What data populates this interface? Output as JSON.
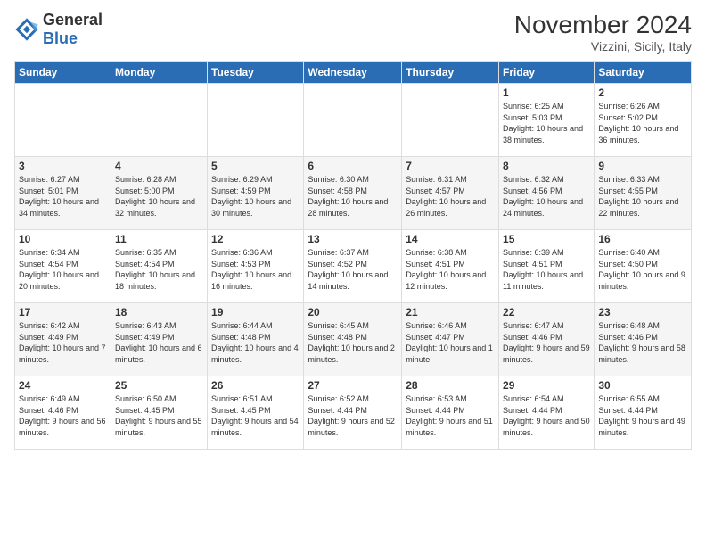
{
  "header": {
    "logo_general": "General",
    "logo_blue": "Blue",
    "month_title": "November 2024",
    "subtitle": "Vizzini, Sicily, Italy"
  },
  "days_of_week": [
    "Sunday",
    "Monday",
    "Tuesday",
    "Wednesday",
    "Thursday",
    "Friday",
    "Saturday"
  ],
  "weeks": [
    [
      {
        "day": "",
        "info": ""
      },
      {
        "day": "",
        "info": ""
      },
      {
        "day": "",
        "info": ""
      },
      {
        "day": "",
        "info": ""
      },
      {
        "day": "",
        "info": ""
      },
      {
        "day": "1",
        "info": "Sunrise: 6:25 AM\nSunset: 5:03 PM\nDaylight: 10 hours and 38 minutes."
      },
      {
        "day": "2",
        "info": "Sunrise: 6:26 AM\nSunset: 5:02 PM\nDaylight: 10 hours and 36 minutes."
      }
    ],
    [
      {
        "day": "3",
        "info": "Sunrise: 6:27 AM\nSunset: 5:01 PM\nDaylight: 10 hours and 34 minutes."
      },
      {
        "day": "4",
        "info": "Sunrise: 6:28 AM\nSunset: 5:00 PM\nDaylight: 10 hours and 32 minutes."
      },
      {
        "day": "5",
        "info": "Sunrise: 6:29 AM\nSunset: 4:59 PM\nDaylight: 10 hours and 30 minutes."
      },
      {
        "day": "6",
        "info": "Sunrise: 6:30 AM\nSunset: 4:58 PM\nDaylight: 10 hours and 28 minutes."
      },
      {
        "day": "7",
        "info": "Sunrise: 6:31 AM\nSunset: 4:57 PM\nDaylight: 10 hours and 26 minutes."
      },
      {
        "day": "8",
        "info": "Sunrise: 6:32 AM\nSunset: 4:56 PM\nDaylight: 10 hours and 24 minutes."
      },
      {
        "day": "9",
        "info": "Sunrise: 6:33 AM\nSunset: 4:55 PM\nDaylight: 10 hours and 22 minutes."
      }
    ],
    [
      {
        "day": "10",
        "info": "Sunrise: 6:34 AM\nSunset: 4:54 PM\nDaylight: 10 hours and 20 minutes."
      },
      {
        "day": "11",
        "info": "Sunrise: 6:35 AM\nSunset: 4:54 PM\nDaylight: 10 hours and 18 minutes."
      },
      {
        "day": "12",
        "info": "Sunrise: 6:36 AM\nSunset: 4:53 PM\nDaylight: 10 hours and 16 minutes."
      },
      {
        "day": "13",
        "info": "Sunrise: 6:37 AM\nSunset: 4:52 PM\nDaylight: 10 hours and 14 minutes."
      },
      {
        "day": "14",
        "info": "Sunrise: 6:38 AM\nSunset: 4:51 PM\nDaylight: 10 hours and 12 minutes."
      },
      {
        "day": "15",
        "info": "Sunrise: 6:39 AM\nSunset: 4:51 PM\nDaylight: 10 hours and 11 minutes."
      },
      {
        "day": "16",
        "info": "Sunrise: 6:40 AM\nSunset: 4:50 PM\nDaylight: 10 hours and 9 minutes."
      }
    ],
    [
      {
        "day": "17",
        "info": "Sunrise: 6:42 AM\nSunset: 4:49 PM\nDaylight: 10 hours and 7 minutes."
      },
      {
        "day": "18",
        "info": "Sunrise: 6:43 AM\nSunset: 4:49 PM\nDaylight: 10 hours and 6 minutes."
      },
      {
        "day": "19",
        "info": "Sunrise: 6:44 AM\nSunset: 4:48 PM\nDaylight: 10 hours and 4 minutes."
      },
      {
        "day": "20",
        "info": "Sunrise: 6:45 AM\nSunset: 4:48 PM\nDaylight: 10 hours and 2 minutes."
      },
      {
        "day": "21",
        "info": "Sunrise: 6:46 AM\nSunset: 4:47 PM\nDaylight: 10 hours and 1 minute."
      },
      {
        "day": "22",
        "info": "Sunrise: 6:47 AM\nSunset: 4:46 PM\nDaylight: 9 hours and 59 minutes."
      },
      {
        "day": "23",
        "info": "Sunrise: 6:48 AM\nSunset: 4:46 PM\nDaylight: 9 hours and 58 minutes."
      }
    ],
    [
      {
        "day": "24",
        "info": "Sunrise: 6:49 AM\nSunset: 4:46 PM\nDaylight: 9 hours and 56 minutes."
      },
      {
        "day": "25",
        "info": "Sunrise: 6:50 AM\nSunset: 4:45 PM\nDaylight: 9 hours and 55 minutes."
      },
      {
        "day": "26",
        "info": "Sunrise: 6:51 AM\nSunset: 4:45 PM\nDaylight: 9 hours and 54 minutes."
      },
      {
        "day": "27",
        "info": "Sunrise: 6:52 AM\nSunset: 4:44 PM\nDaylight: 9 hours and 52 minutes."
      },
      {
        "day": "28",
        "info": "Sunrise: 6:53 AM\nSunset: 4:44 PM\nDaylight: 9 hours and 51 minutes."
      },
      {
        "day": "29",
        "info": "Sunrise: 6:54 AM\nSunset: 4:44 PM\nDaylight: 9 hours and 50 minutes."
      },
      {
        "day": "30",
        "info": "Sunrise: 6:55 AM\nSunset: 4:44 PM\nDaylight: 9 hours and 49 minutes."
      }
    ]
  ]
}
